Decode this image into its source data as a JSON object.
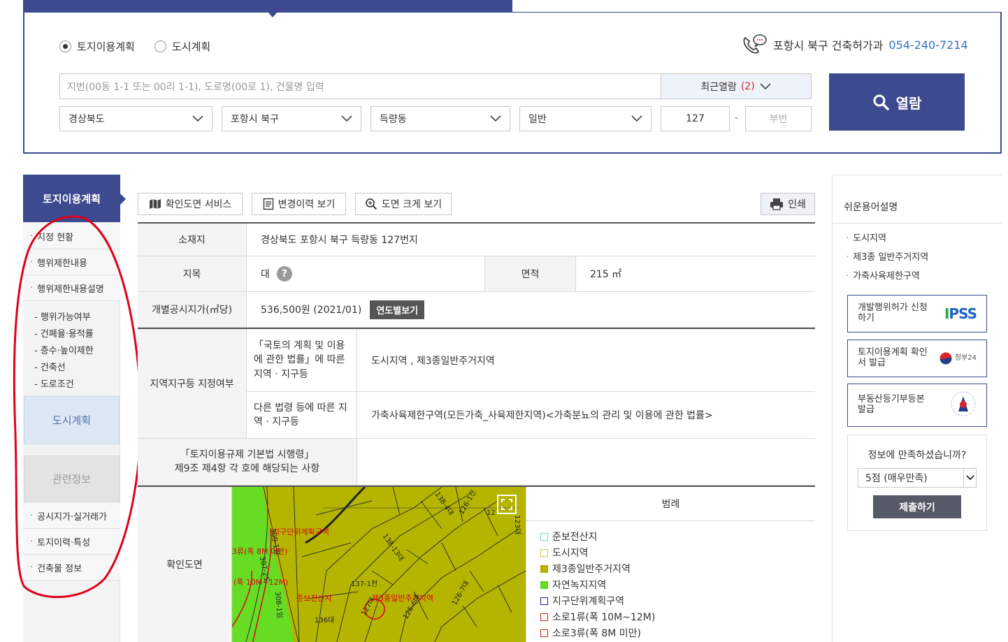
{
  "top": {
    "radio": [
      {
        "label": "토지이용계획",
        "selected": true
      },
      {
        "label": "도시계획",
        "selected": false
      }
    ],
    "contact": {
      "label": "포항시 북구 건축허가과",
      "phone": "054-240-7214"
    },
    "search_placeholder": "지번(00동 1-1 또는 00리 1-1), 도로명(00로 1), 건물명 입력",
    "recent": {
      "label": "최근열람",
      "count": "(2)"
    },
    "selects": [
      "경상북도",
      "포항시 북구",
      "득량동",
      "일반"
    ],
    "main_no": "127",
    "dash": "-",
    "sub_no_placeholder": "부번",
    "view_button": "열람"
  },
  "left_menu": {
    "title": "토지이용계획",
    "items_top": [
      "지정 현황",
      "행위제한내용",
      "행위제한내용설명"
    ],
    "sub_items": [
      "- 행위가능여부",
      "- 건폐율·용적률",
      "- 층수·높이제한",
      "- 건축선",
      "- 도로조건"
    ],
    "city_plan": "도시계획",
    "related": "관련정보",
    "items_bottom": [
      "공시지가·실거래가",
      "토지이력·특성",
      "건축물 정보"
    ]
  },
  "tools": {
    "confirm_map": "확인도면 서비스",
    "history": "변경이력 보기",
    "enlarge": "도면 크게 보기",
    "print": "인쇄"
  },
  "table": {
    "location_label": "소재지",
    "location": "경상북도 포항시 북구 득량동 127번지",
    "land_type_label": "지목",
    "land_type": "대",
    "area_label": "면적",
    "area": "215 ㎡",
    "price_label": "개별공시지가(㎡당)",
    "price": "536,500원 (2021/01)",
    "price_btn": "연도별보기",
    "zone_label": "지역지구등 지정여부",
    "zone_law1_label": "「국토의 계획 및 이용에 관한 법률」에 따른 지역 · 지구등",
    "zone_law1": "도시지역 , 제3종일반주거지역",
    "zone_law2_label": "다른 법령 등에 따른 지역 · 지구등",
    "zone_law2": "가축사육제한구역(모든가축_사육제한지역)<가축분뇨의 관리 및 이용에 관한 법률>",
    "enforce_label_1": "「토지이용규제 기본법 시행령」",
    "enforce_label_2": "제9조 제4항 각 호에 해당되는 사항",
    "map_label": "확인도면",
    "legend_title": "범례",
    "legend": [
      {
        "label": "준보전산지",
        "color": "#7fd0d0",
        "fill": "#ffffff"
      },
      {
        "label": "도시지역",
        "color": "#d2c24a",
        "fill": "#ffffff"
      },
      {
        "label": "제3종일반주거지역",
        "color": "#a8a800",
        "fill": "#b5b500"
      },
      {
        "label": "자연녹지지역",
        "color": "#55cc22",
        "fill": "#66dd22"
      },
      {
        "label": "지구단위계획구역",
        "color": "#22228a",
        "fill": "#ffffff"
      },
      {
        "label": "소로1류(폭 10M~12M)",
        "color": "#cc2222",
        "fill": "#ffffff"
      },
      {
        "label": "소로3류(폭 8M 미만)",
        "color": "#cc2222",
        "fill": "#ffffff"
      }
    ],
    "map_labels": [
      "지구단위계획구역",
      "3류(폭 8M 미만)",
      "(폭 10M~12M)",
      "준보전산지",
      "제3종일반주거지역",
      "136대",
      "137-1전",
      "309-1임",
      "307-2도",
      "308-1임",
      "138-4대",
      "138-13대",
      "126-1전",
      "126-6대",
      "126-7대",
      "127대",
      "12",
      "123대"
    ]
  },
  "right": {
    "terms_title": "쉬운용어설명",
    "terms": [
      "도시지역",
      "제3종 일반주거지역",
      "가축사육제한구역"
    ],
    "links": [
      {
        "label": "개발행위허가 신청하기",
        "logo": "IPSS"
      },
      {
        "label": "토지이용계획 확인서 발급",
        "logo": "정부24"
      },
      {
        "label": "부동산등기부등본 발급",
        "logo": ""
      }
    ],
    "survey_q": "정보에 만족하셨습니까?",
    "survey_value": "5점 (매우만족)",
    "survey_submit": "제출하기"
  }
}
